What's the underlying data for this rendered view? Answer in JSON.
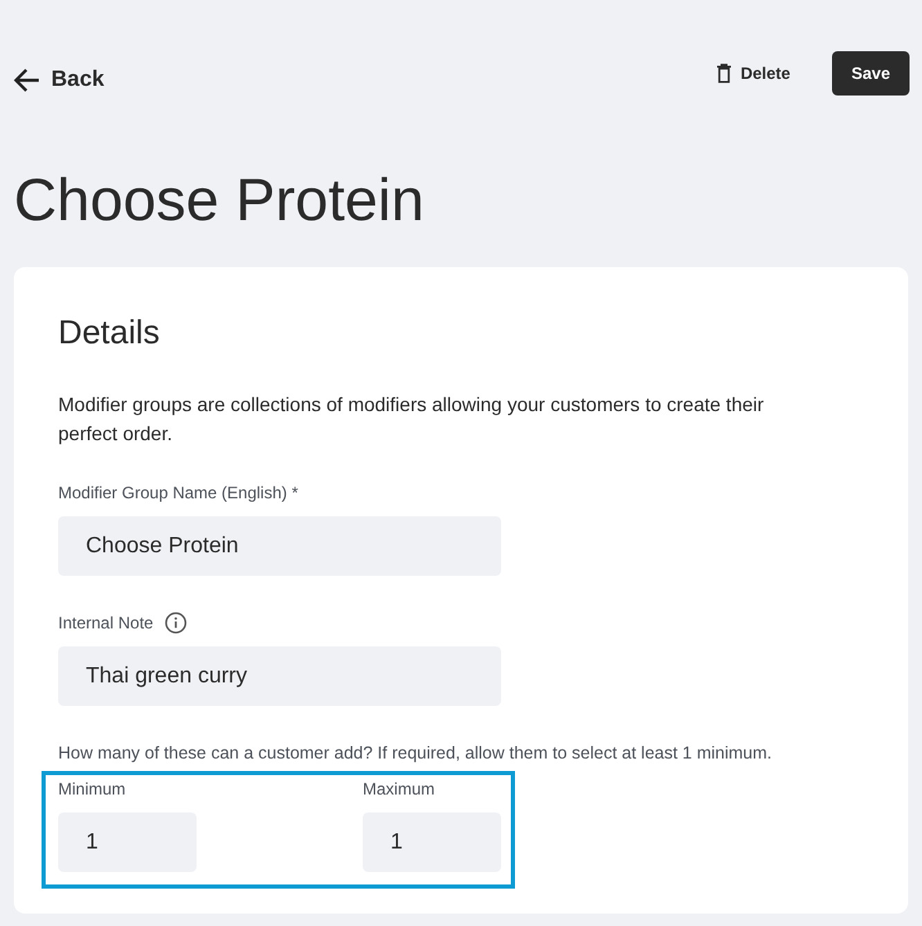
{
  "header": {
    "back": {
      "label": "Back"
    },
    "actions": [
      {
        "kind": "icon-text",
        "label": "Delete"
      },
      {
        "kind": "filled",
        "label": "Save"
      }
    ]
  },
  "title": "Choose Protein",
  "details": {
    "heading": "Details",
    "description": "Modifier groups are collections of modifiers allowing your customers to create their perfect order.",
    "fields": [
      {
        "label": "Modifier Group Name (English) *",
        "value": "Choose Protein",
        "info": false
      },
      {
        "label": "Internal Note",
        "value": "Thai green curry",
        "info": true
      }
    ],
    "quantity": {
      "hint": "How many of these can a customer add? If required, allow them to select at least 1 minimum.",
      "highlighted": true,
      "fields": [
        {
          "label": "Minimum",
          "value": "1"
        },
        {
          "label": "Maximum",
          "value": "1"
        }
      ]
    }
  }
}
